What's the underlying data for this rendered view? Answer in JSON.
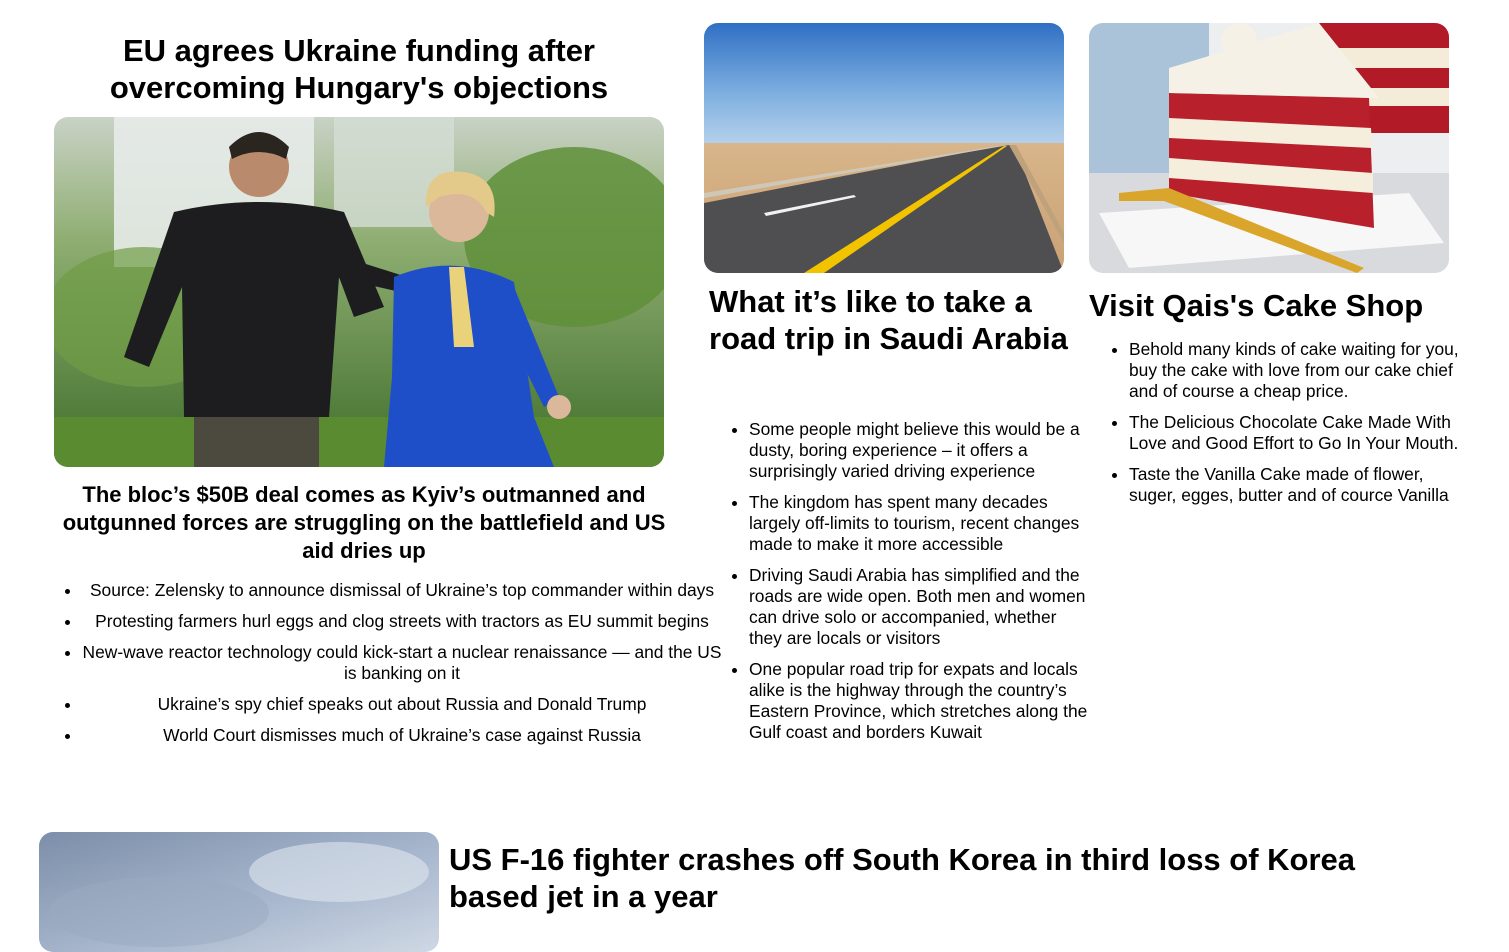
{
  "main_story": {
    "title": "EU agrees Ukraine funding after overcoming Hungary's objections",
    "subtitle": "The bloc’s $50B deal comes as Kyiv’s outmanned and outgunned forces are struggling on the battlefield and US aid dries up",
    "related": [
      "Source: Zelensky to announce dismissal of Ukraine’s top commander within days",
      "Protesting farmers hurl eggs and clog streets with tractors as EU summit begins",
      "New-wave reactor technology could kick-start a nuclear renaissance — and the US is banking on it",
      "Ukraine’s spy chief speaks out about Russia and Donald Trump",
      "World Court dismisses much of Ukraine’s case against Russia"
    ]
  },
  "saudi_card": {
    "title": "What it’s like to take a road trip in Saudi Arabia",
    "bullets": [
      "Some people might believe this would be a dusty, boring experience – it offers a surprisingly varied driving experience",
      "The kingdom has spent many decades largely off-limits to tourism, recent changes made to make it more accessible",
      "Driving Saudi Arabia has simplified and the roads are wide open. Both men and women can drive solo or accompanied, whether they are locals or visitors",
      "One popular road trip for expats and locals alike is the highway through the country’s Eastern Province, which stretches along the Gulf coast and borders Kuwait"
    ]
  },
  "cake_card": {
    "title": "Visit Qais's Cake Shop",
    "bullets": [
      "Behold many kinds of cake waiting for you, buy the cake with love from our cake chief and of course a cheap price.",
      "The Delicious Chocolate Cake Made With Love and Good Effort to Go In Your Mouth.",
      "Taste the Vanilla Cake made of flower, suger, egges, butter and of cource Vanilla"
    ]
  },
  "bottom_story": {
    "title": "US F-16 fighter crashes off South Korea in third loss of Korea based jet in a year"
  }
}
